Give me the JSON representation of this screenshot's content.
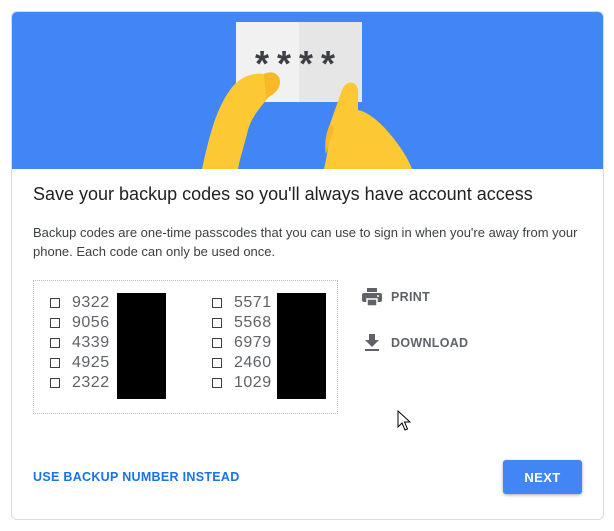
{
  "hero": {
    "card_text": "****",
    "illustration": "hands-holding-backup-code-card"
  },
  "title": "Save your backup codes so you'll always have account access",
  "description": "Backup codes are one-time passcodes that you can use to sign in when you're away from your phone. Each code can only be used once.",
  "codes": {
    "column1": [
      "9322",
      "9056",
      "4339",
      "4925",
      "2322"
    ],
    "column2": [
      "5571",
      "5568",
      "6979",
      "2460",
      "1029"
    ]
  },
  "actions": {
    "print_label": "PRINT",
    "print_icon": "printer-icon",
    "download_label": "DOWNLOAD",
    "download_icon": "download-icon"
  },
  "footer": {
    "alt_link": "USE BACKUP NUMBER INSTEAD",
    "next_label": "NEXT"
  },
  "colors": {
    "accent": "#4285f4",
    "link": "#1a73e8",
    "skin": "#fcc934",
    "card": "#f1f1f1"
  }
}
